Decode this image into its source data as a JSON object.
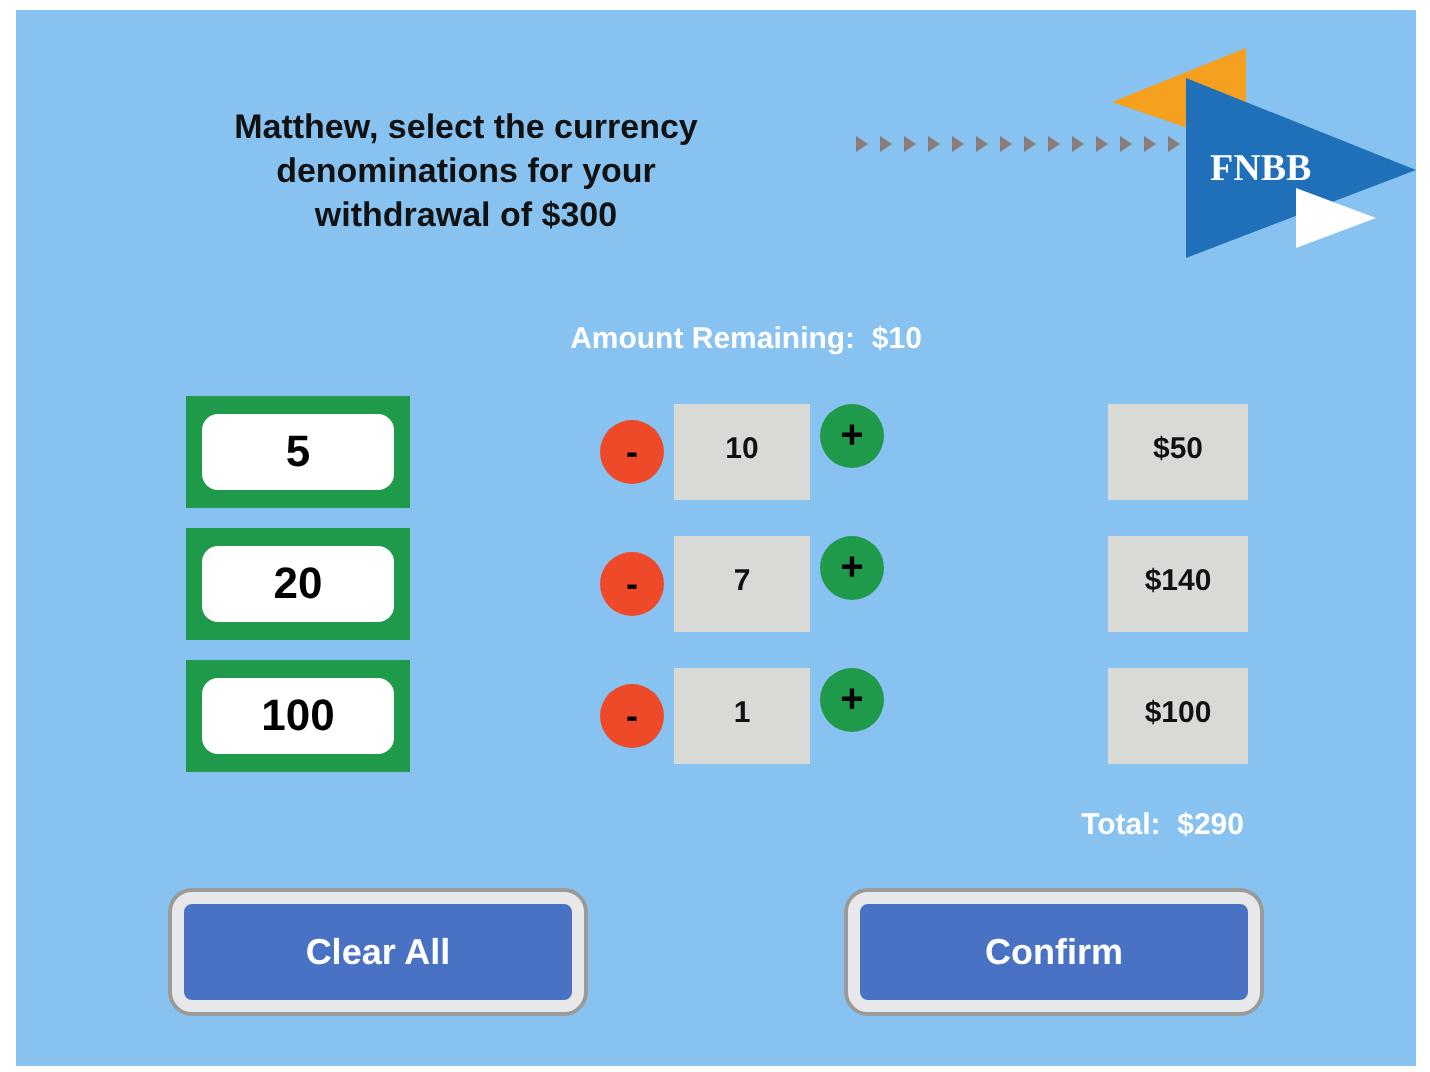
{
  "heading": "Matthew, select the currency denominations for your withdrawal of $300",
  "logo": {
    "text": "FNBB"
  },
  "amount_remaining": {
    "label": "Amount Remaining:",
    "value": "$10"
  },
  "rows": [
    {
      "denomination": "5",
      "minus": "-",
      "count": "10",
      "plus": "+",
      "subtotal": "$50"
    },
    {
      "denomination": "20",
      "minus": "-",
      "count": "7",
      "plus": "+",
      "subtotal": "$140"
    },
    {
      "denomination": "100",
      "minus": "-",
      "count": "1",
      "plus": "+",
      "subtotal": "$100"
    }
  ],
  "total": {
    "label": "Total:",
    "value": "$290"
  },
  "buttons": [
    "Clear All",
    "Confirm"
  ]
}
